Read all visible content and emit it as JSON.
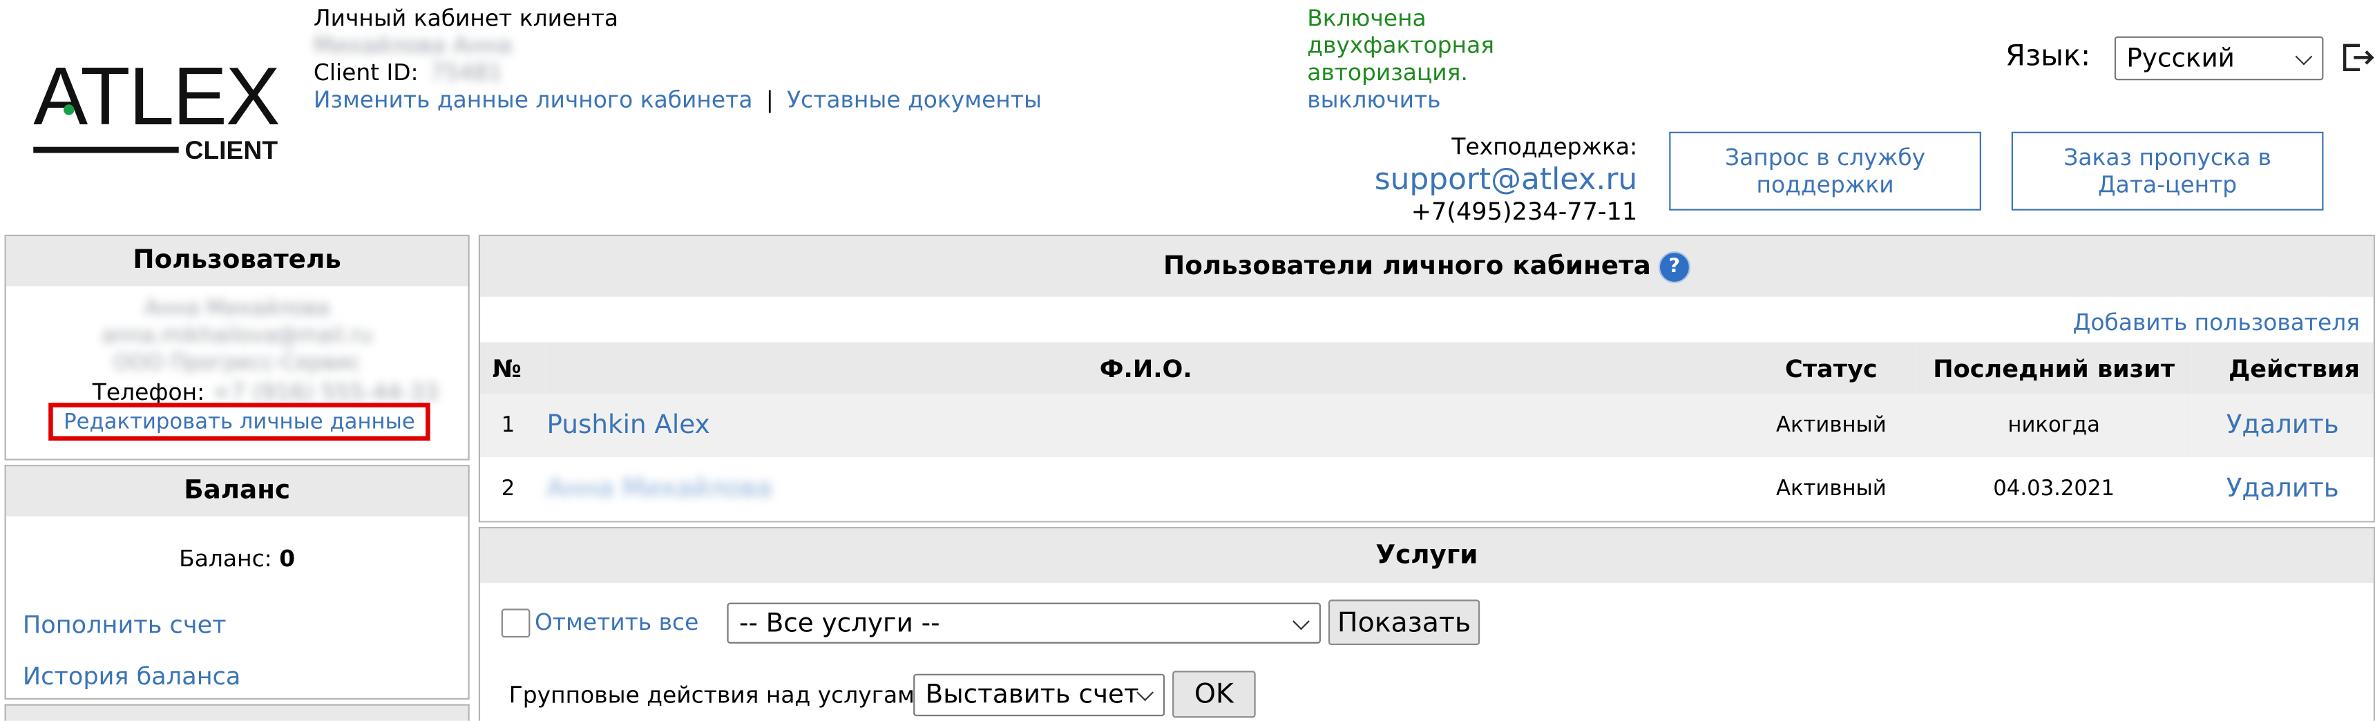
{
  "header": {
    "cabinet_title": "Личный кабинет клиента",
    "client_name": "Михайлова Анна",
    "client_id_label": "Client ID:",
    "client_id_value": "75481",
    "edit_cabinet_link": "Изменить данные личного кабинета",
    "separator": "|",
    "charter_docs_link": "Уставные документы",
    "twofa_line1": "Включена",
    "twofa_line2": "двухфакторная",
    "twofa_line3": "авторизация.",
    "twofa_disable": "выключить",
    "language_label": "Язык:",
    "language_value": "Русский",
    "support_label": "Техподдержка:",
    "support_email": "support@atlex.ru",
    "support_phone": "+7(495)234-77-11",
    "support_request_button": "Запрос в службу поддержки",
    "datacenter_pass_button": "Заказ пропуска в Дата-центр",
    "logo_main": "ATLEX",
    "logo_sub": "CLIENT"
  },
  "user_panel": {
    "title": "Пользователь",
    "blurred_name": "Анна Михайлова",
    "blurred_email": "anna.mikhailova@mail.ru",
    "blurred_company": "ООО Прогресс-Сервис",
    "phone_label": "Телефон:",
    "phone_value": "+7 (916) 555-44-33",
    "edit_personal_link": "Редактировать личные данные"
  },
  "balance_panel": {
    "title": "Баланс",
    "balance_label": "Баланс:",
    "balance_value": "0",
    "topup_link": "Пополнить счет",
    "history_link": "История баланса"
  },
  "users_panel": {
    "title": "Пользователи личного кабинета",
    "add_user_link": "Добавить пользователя",
    "columns": [
      "№",
      "Ф.И.О.",
      "Статус",
      "Последний визит",
      "Действия"
    ],
    "rows": [
      {
        "num": "1",
        "name": "Pushkin Alex",
        "status": "Активный",
        "last_visit": "никогда",
        "action": "Удалить"
      },
      {
        "num": "2",
        "name": "Анна Михайлова",
        "status": "Активный",
        "last_visit": "04.03.2021",
        "action": "Удалить"
      }
    ]
  },
  "services_panel": {
    "title": "Услуги",
    "select_all_label": "Отметить все",
    "services_select_value": "-- Все услуги --",
    "show_button": "Показать",
    "group_actions_label": "Групповые действия над услугами",
    "group_action_value": "Выставить счет",
    "ok_button": "OK"
  },
  "colors": {
    "link": "#3b74b7",
    "green": "#1f8a1f",
    "highlight_red": "#e10000",
    "panel_header_bg": "#e9e9e9"
  }
}
